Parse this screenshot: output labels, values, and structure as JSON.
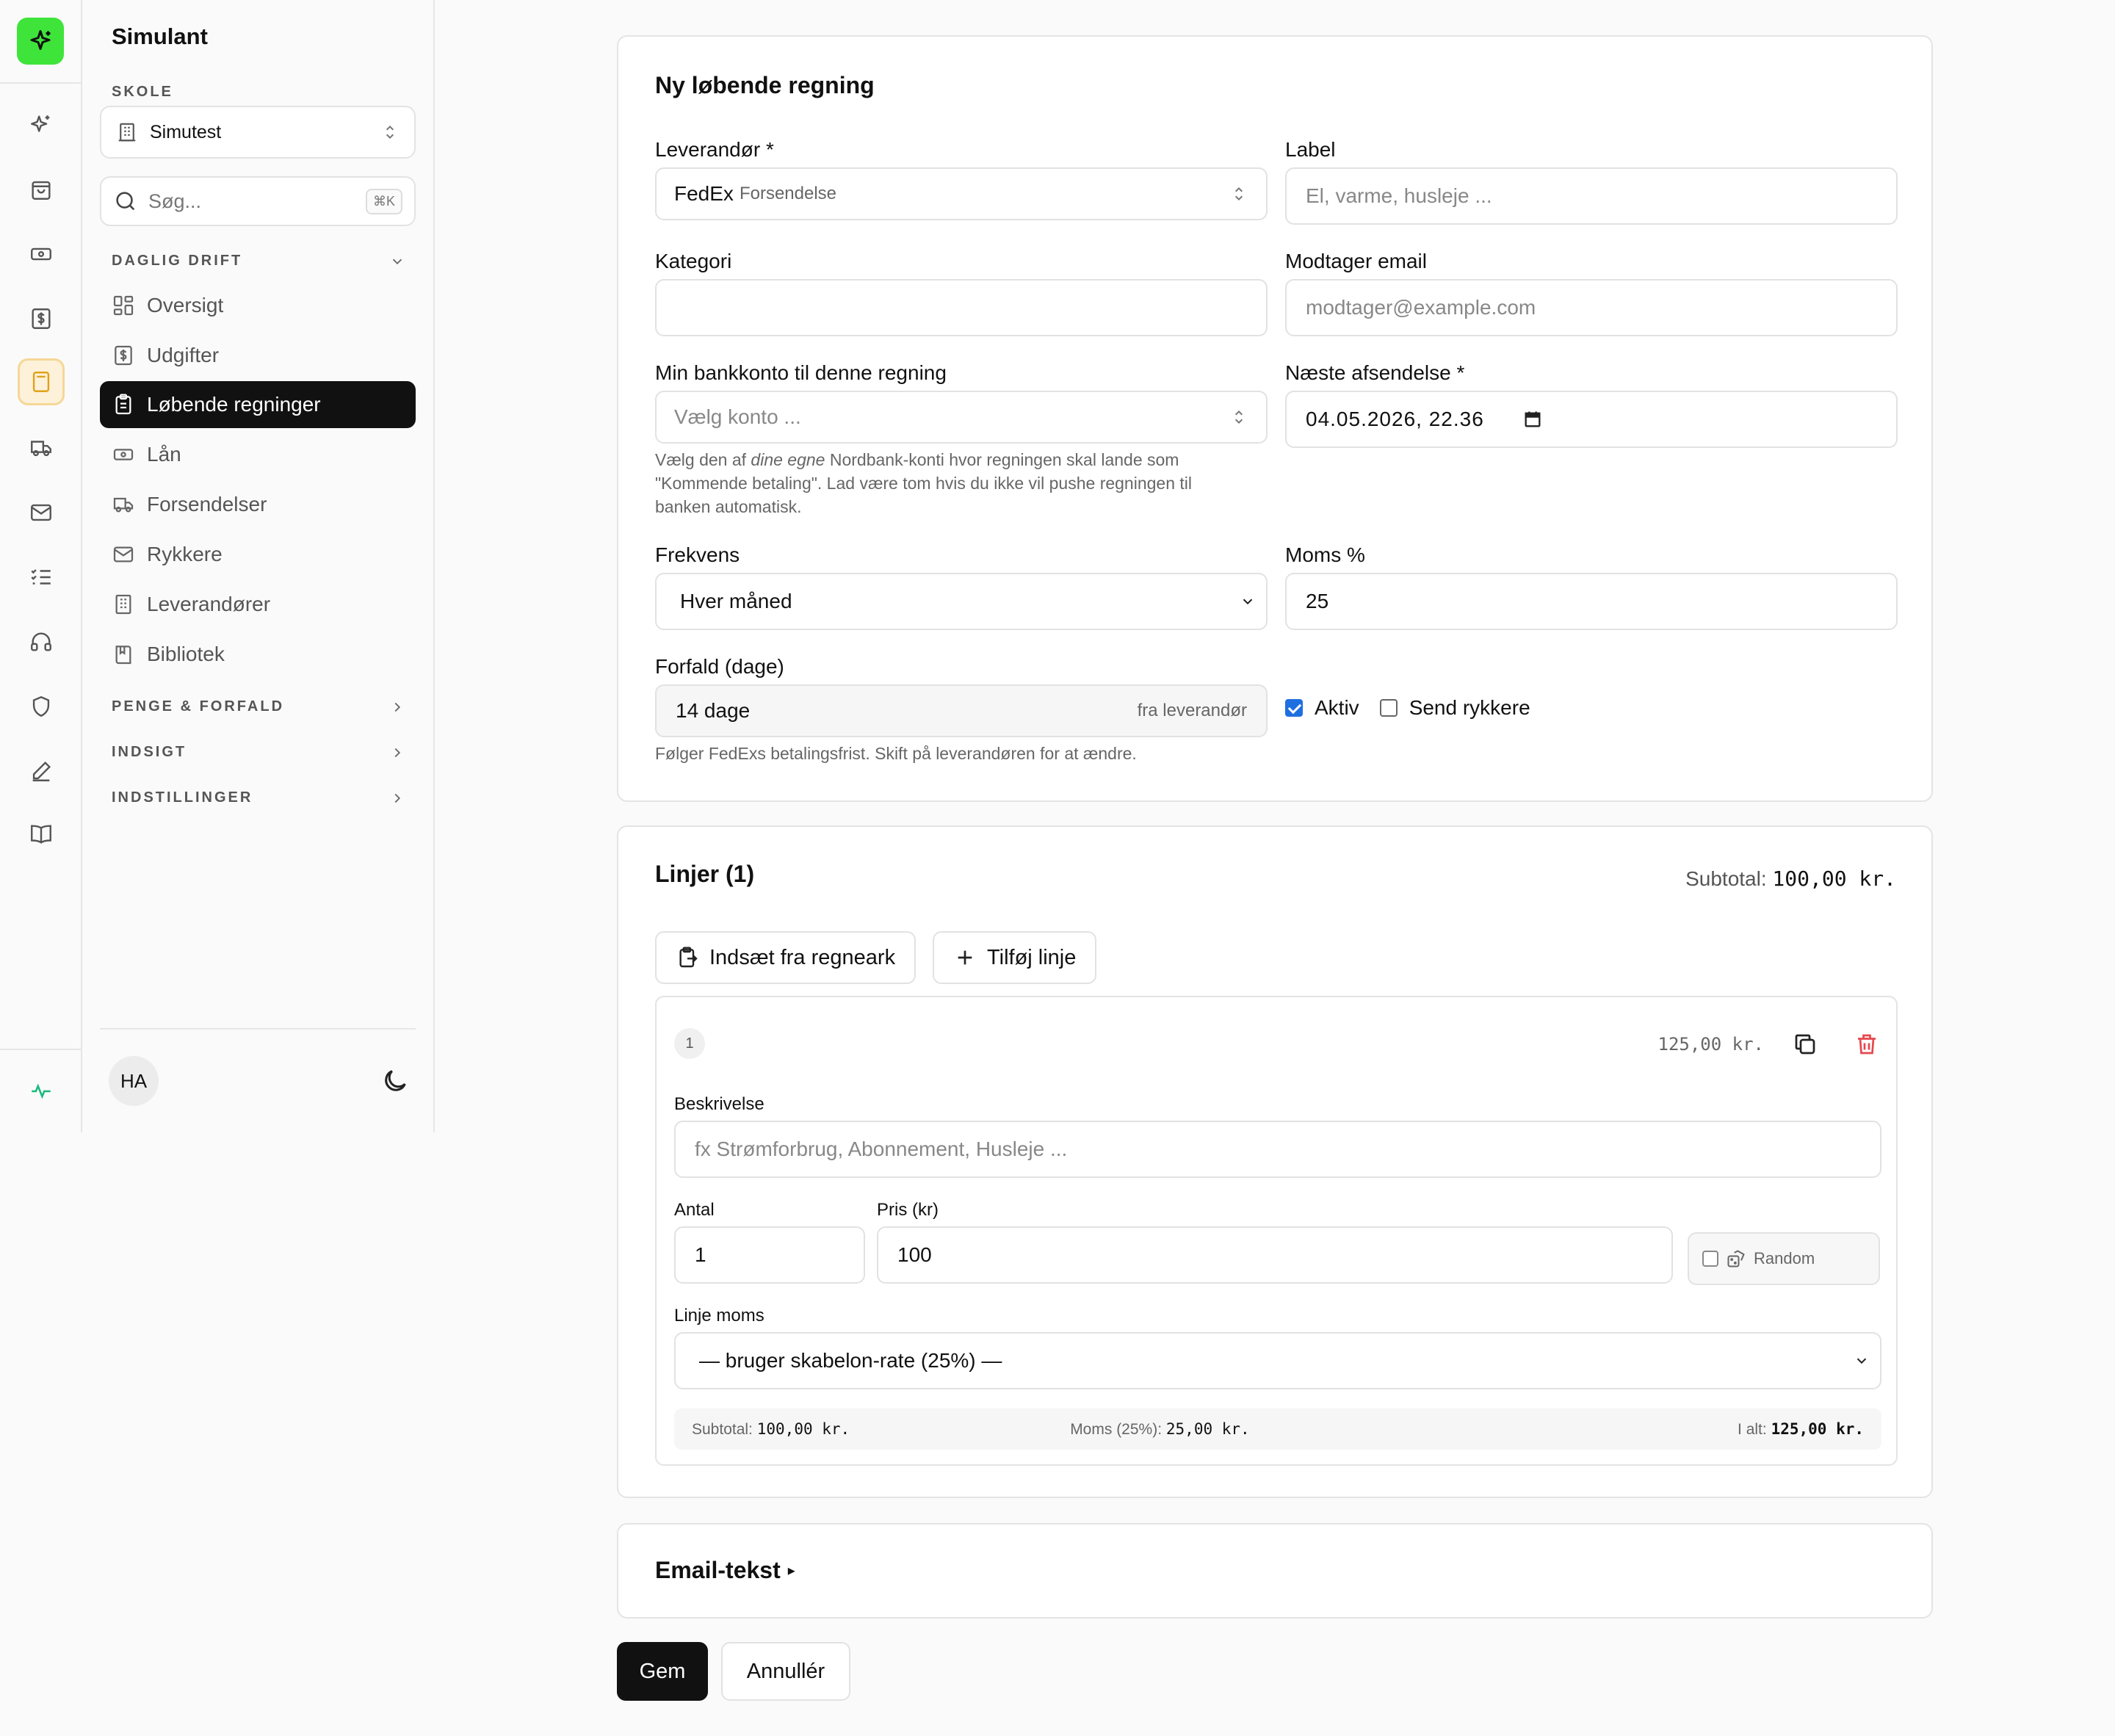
{
  "app": {
    "title": "Simulant"
  },
  "sidebar": {
    "school_caption": "SKOLE",
    "school_value": "Simutest",
    "search_placeholder": "Søg...",
    "search_shortcut": "⌘K",
    "groups": [
      {
        "label": "DAGLIG DRIFT",
        "expanded": true
      },
      {
        "label": "PENGE & FORFALD",
        "expanded": false
      },
      {
        "label": "INDSIGT",
        "expanded": false
      },
      {
        "label": "INDSTILLINGER",
        "expanded": false
      }
    ],
    "items": [
      {
        "label": "Oversigt",
        "icon": "dashboard-icon"
      },
      {
        "label": "Udgifter",
        "icon": "dollar-receipt-icon"
      },
      {
        "label": "Løbende regninger",
        "icon": "clipboard-icon",
        "active": true
      },
      {
        "label": "Lån",
        "icon": "banknote-icon"
      },
      {
        "label": "Forsendelser",
        "icon": "truck-icon"
      },
      {
        "label": "Rykkere",
        "icon": "mail-icon"
      },
      {
        "label": "Leverandører",
        "icon": "building-icon"
      },
      {
        "label": "Bibliotek",
        "icon": "book-icon"
      }
    ],
    "user_initials": "HA"
  },
  "rail": {
    "icons": [
      "sparkles-icon",
      "shopping-bag-icon",
      "banknote-icon",
      "dollar-receipt-icon",
      "calculator-icon",
      "truck-icon",
      "mail-icon",
      "checklist-icon",
      "headphones-icon",
      "shield-icon",
      "pen-icon",
      "book-open-icon",
      "activity-icon"
    ]
  },
  "form": {
    "title": "Ny løbende regning",
    "supplier_label": "Leverandør *",
    "supplier_value": "FedEx",
    "supplier_sub": "Forsendelse",
    "label_label": "Label",
    "label_placeholder": "El, varme, husleje ...",
    "category_label": "Kategori",
    "category_value": "",
    "recipient_label": "Modtager email",
    "recipient_placeholder": "modtager@example.com",
    "bank_label": "Min bankkonto til denne regning",
    "bank_placeholder": "Vælg konto ...",
    "bank_help_1": "Vælg den af ",
    "bank_help_em": "dine egne",
    "bank_help_2": " Nordbank-konti hvor regningen skal lande som \"Kommende betaling\". Lad være tom hvis du ikke vil pushe regningen til banken automatisk.",
    "next_label": "Næste afsendelse *",
    "next_value": "04.05.2026, 22.36",
    "freq_label": "Frekvens",
    "freq_value": "Hver måned",
    "vat_label": "Moms %",
    "vat_value": "25",
    "due_label": "Forfald (dage)",
    "due_value": "14 dage",
    "due_suffix": "fra leverandør",
    "due_help": "Følger FedExs betalingsfrist. Skift på leverandøren for at ændre.",
    "active_label": "Aktiv",
    "active_checked": true,
    "reminders_label": "Send rykkere",
    "reminders_checked": false
  },
  "lines": {
    "title": "Linjer (1)",
    "subtotal_label": "Subtotal:",
    "subtotal_value": "100,00 kr.",
    "paste_button": "Indsæt fra regneark",
    "add_button": "Tilføj linje",
    "items": [
      {
        "index": "1",
        "total": "125,00 kr.",
        "desc_label": "Beskrivelse",
        "desc_placeholder": "fx Strømforbrug, Abonnement, Husleje ...",
        "qty_label": "Antal",
        "qty_value": "1",
        "price_label": "Pris (kr)",
        "price_value": "100",
        "random_label": "Random",
        "vat_label": "Linje moms",
        "vat_value": "— bruger skabelon-rate (25%) —",
        "sum_subtotal_label": "Subtotal:",
        "sum_subtotal_value": "100,00 kr.",
        "sum_vat_label": "Moms (25%):",
        "sum_vat_value": "25,00 kr.",
        "sum_total_label": "I alt:",
        "sum_total_value": "125,00 kr."
      }
    ]
  },
  "email": {
    "title": "Email-tekst",
    "toggle": "▸"
  },
  "actions": {
    "save": "Gem",
    "cancel": "Annullér"
  },
  "colors": {
    "accent": "#3ee43a",
    "active_nav": "#111111",
    "danger": "#e5484d",
    "rail_active_bg": "#fdf1d9"
  }
}
